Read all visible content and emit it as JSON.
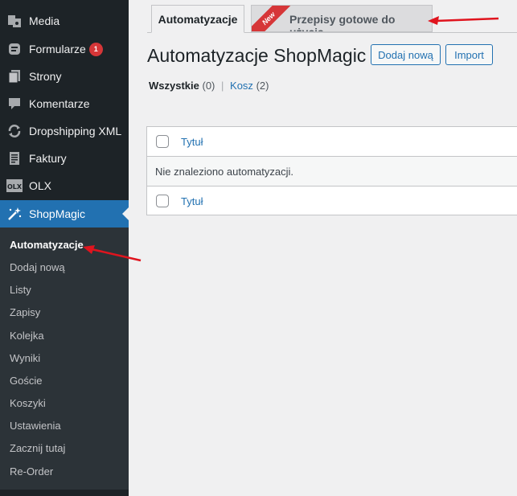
{
  "sidebar": {
    "items": [
      {
        "label": "Media",
        "icon": "media-icon"
      },
      {
        "label": "Formularze",
        "icon": "forms-icon",
        "badge": "1"
      },
      {
        "label": "Strony",
        "icon": "pages-icon"
      },
      {
        "label": "Komentarze",
        "icon": "comments-icon"
      },
      {
        "label": "Dropshipping XML",
        "icon": "sync-icon"
      },
      {
        "label": "Faktury",
        "icon": "invoice-icon"
      },
      {
        "label": "OLX",
        "icon": "olx-logo-icon"
      },
      {
        "label": "ShopMagic",
        "icon": "magic-wand-icon"
      }
    ],
    "submenu": [
      {
        "label": "Automatyzacje",
        "current": true
      },
      {
        "label": "Dodaj nową"
      },
      {
        "label": "Listy"
      },
      {
        "label": "Zapisy"
      },
      {
        "label": "Kolejka"
      },
      {
        "label": "Wyniki"
      },
      {
        "label": "Goście"
      },
      {
        "label": "Koszyki"
      },
      {
        "label": "Ustawienia"
      },
      {
        "label": "Zacznij tutaj"
      },
      {
        "label": "Re-Order"
      }
    ]
  },
  "tabs": {
    "active": "Automatyzacje",
    "recipes": "Przepisy gotowe do użycia",
    "new_ribbon": "New"
  },
  "header": {
    "title": "Automatyzacje ShopMagic",
    "add_new": "Dodaj nową",
    "import": "Import"
  },
  "filters": {
    "all": "Wszystkie",
    "all_count": "(0)",
    "separator": "|",
    "trash": "Kosz",
    "trash_count": "(2)"
  },
  "table": {
    "column_title": "Tytuł",
    "empty_message": "Nie znaleziono automatyzacji."
  },
  "colors": {
    "sidebar": "#1d2327",
    "submenu": "#2c3338",
    "accent": "#2271b1",
    "badge": "#d63638",
    "annotation_arrow": "#e0141e"
  }
}
